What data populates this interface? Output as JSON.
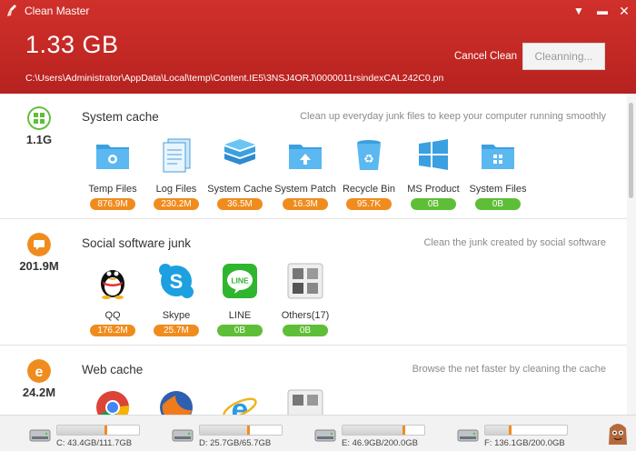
{
  "app": {
    "title": "Clean Master"
  },
  "header": {
    "total_size": "1.33 GB",
    "current_path": "C:\\Users\\Administrator\\AppData\\Local\\temp\\Content.IE5\\3NSJ4ORJ\\0000011rsindexCAL242C0.pn",
    "cancel_label": "Cancel Clean",
    "clean_button_label": "Cleanning..."
  },
  "sections": [
    {
      "title": "System cache",
      "size": "1.1G",
      "description": "Clean up everyday junk files to keep your computer running smoothly",
      "items": [
        {
          "label": "Temp Files",
          "value": "876.9M"
        },
        {
          "label": "Log Files",
          "value": "230.2M"
        },
        {
          "label": "System Cache",
          "value": "36.5M"
        },
        {
          "label": "System Patch",
          "value": "16.3M"
        },
        {
          "label": "Recycle Bin",
          "value": "95.7K"
        },
        {
          "label": "MS Product",
          "value": "0B"
        },
        {
          "label": "System Files",
          "value": "0B"
        }
      ]
    },
    {
      "title": "Social software junk",
      "size": "201.9M",
      "description": "Clean the junk created by social software",
      "items": [
        {
          "label": "QQ",
          "value": "176.2M"
        },
        {
          "label": "Skype",
          "value": "25.7M"
        },
        {
          "label": "LINE",
          "value": "0B",
          "icon_text": "LINE"
        },
        {
          "label": "Others(17)",
          "value": "0B"
        }
      ]
    },
    {
      "title": "Web cache",
      "size": "24.2M",
      "description": "Browse the net faster by cleaning the cache",
      "items": []
    }
  ],
  "drives": [
    {
      "label": "C: 43.4GB/111.7GB",
      "used_fraction": 0.61
    },
    {
      "label": "D: 25.7GB/65.7GB",
      "used_fraction": 0.61
    },
    {
      "label": "E: 46.9GB/200.0GB",
      "used_fraction": 0.77
    },
    {
      "label": "F: 136.1GB/200.0GB",
      "used_fraction": 0.32
    }
  ],
  "colors": {
    "header_red": "#c22824",
    "badge_orange": "#f08c1e",
    "badge_green": "#5fbe37"
  }
}
